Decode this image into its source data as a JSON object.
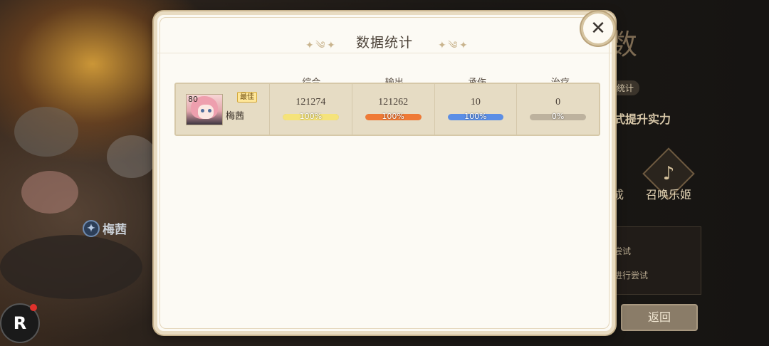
{
  "background": {
    "hero_chip_label": "梅茜",
    "big_char": "数",
    "pill_label": "统计",
    "subtitle": "式提升实力",
    "feature_1_label": "成",
    "feature_2_label": "召唤乐姬",
    "list_item_1": "尝试",
    "list_item_2": "进行尝试",
    "return_label": "返回",
    "logo_label": "R"
  },
  "dialog": {
    "title": "数据统计",
    "close_icon": "close-icon",
    "columns": [
      "综合",
      "输出",
      "承伤",
      "治疗"
    ],
    "rows": [
      {
        "hero_name": "梅茜",
        "level": "80",
        "badge": "最佳",
        "stats": [
          {
            "value": "121274",
            "percent_label": "100%",
            "percent": 100,
            "color": "#f5e37a"
          },
          {
            "value": "121262",
            "percent_label": "100%",
            "percent": 100,
            "color": "#ef7a36"
          },
          {
            "value": "10",
            "percent_label": "100%",
            "percent": 100,
            "color": "#5b8ee6"
          },
          {
            "value": "0",
            "percent_label": "0%",
            "percent": 0,
            "color": "#bdb29e"
          }
        ]
      }
    ]
  }
}
